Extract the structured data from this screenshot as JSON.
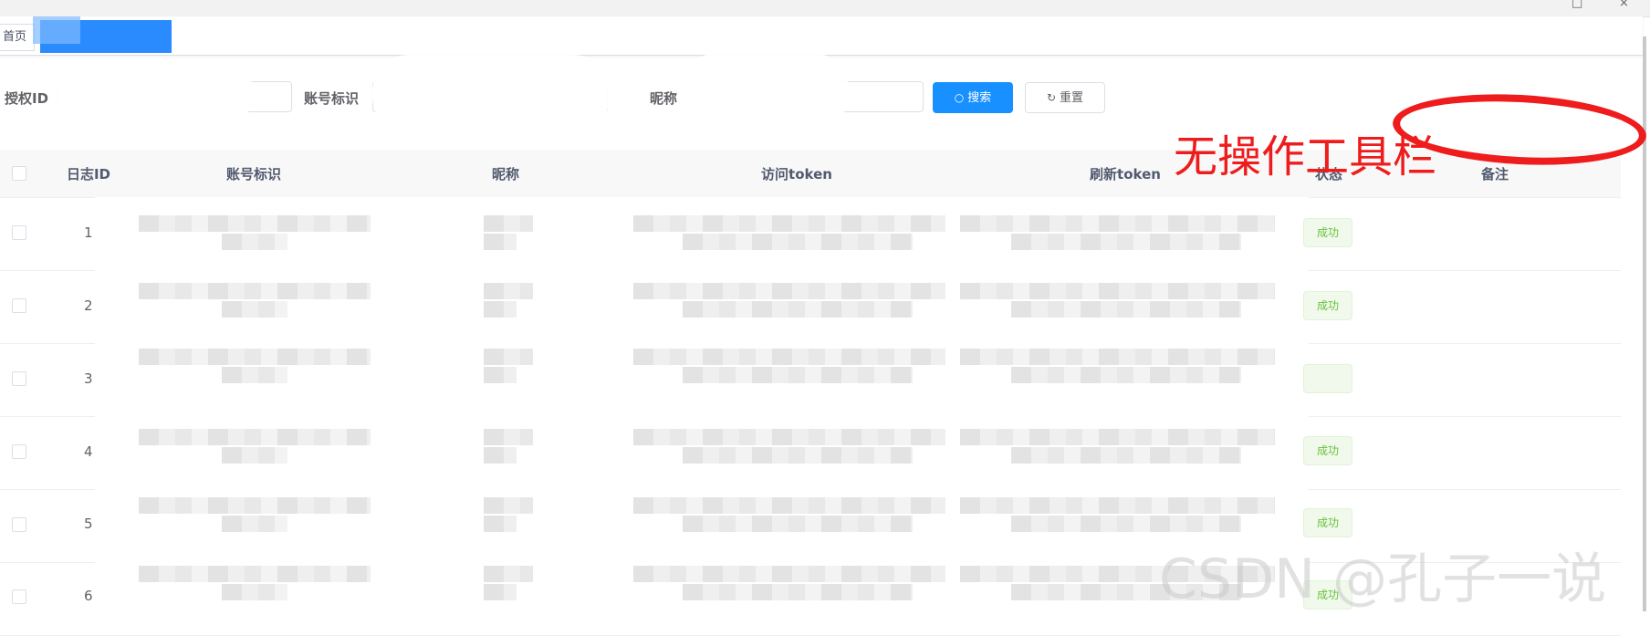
{
  "window": {
    "controls": [
      "□",
      "×"
    ]
  },
  "tabs": {
    "home_label": "首页"
  },
  "search": {
    "auth_id_label": "授权ID",
    "account_label": "账号标识",
    "nickname_label": "昵称",
    "search_button": "搜索",
    "reset_button": "重置",
    "search_icon": "search-icon",
    "reset_icon": "refresh-icon"
  },
  "table": {
    "columns": [
      "日志ID",
      "账号标识",
      "昵称",
      "访问token",
      "刷新token",
      "状态",
      "备注"
    ],
    "rows": [
      {
        "id": "1",
        "status": "成功"
      },
      {
        "id": "2",
        "status": "成功"
      },
      {
        "id": "3",
        "status": ""
      },
      {
        "id": "4",
        "status": "成功"
      },
      {
        "id": "5",
        "status": "成功"
      },
      {
        "id": "6",
        "status": "成功"
      }
    ]
  },
  "annotation": {
    "text": "无操作工具栏",
    "color": "#ee1c1c"
  },
  "watermark": "CSDN @孔子一说",
  "colors": {
    "primary": "#1890ff",
    "success": "#67c23a"
  }
}
